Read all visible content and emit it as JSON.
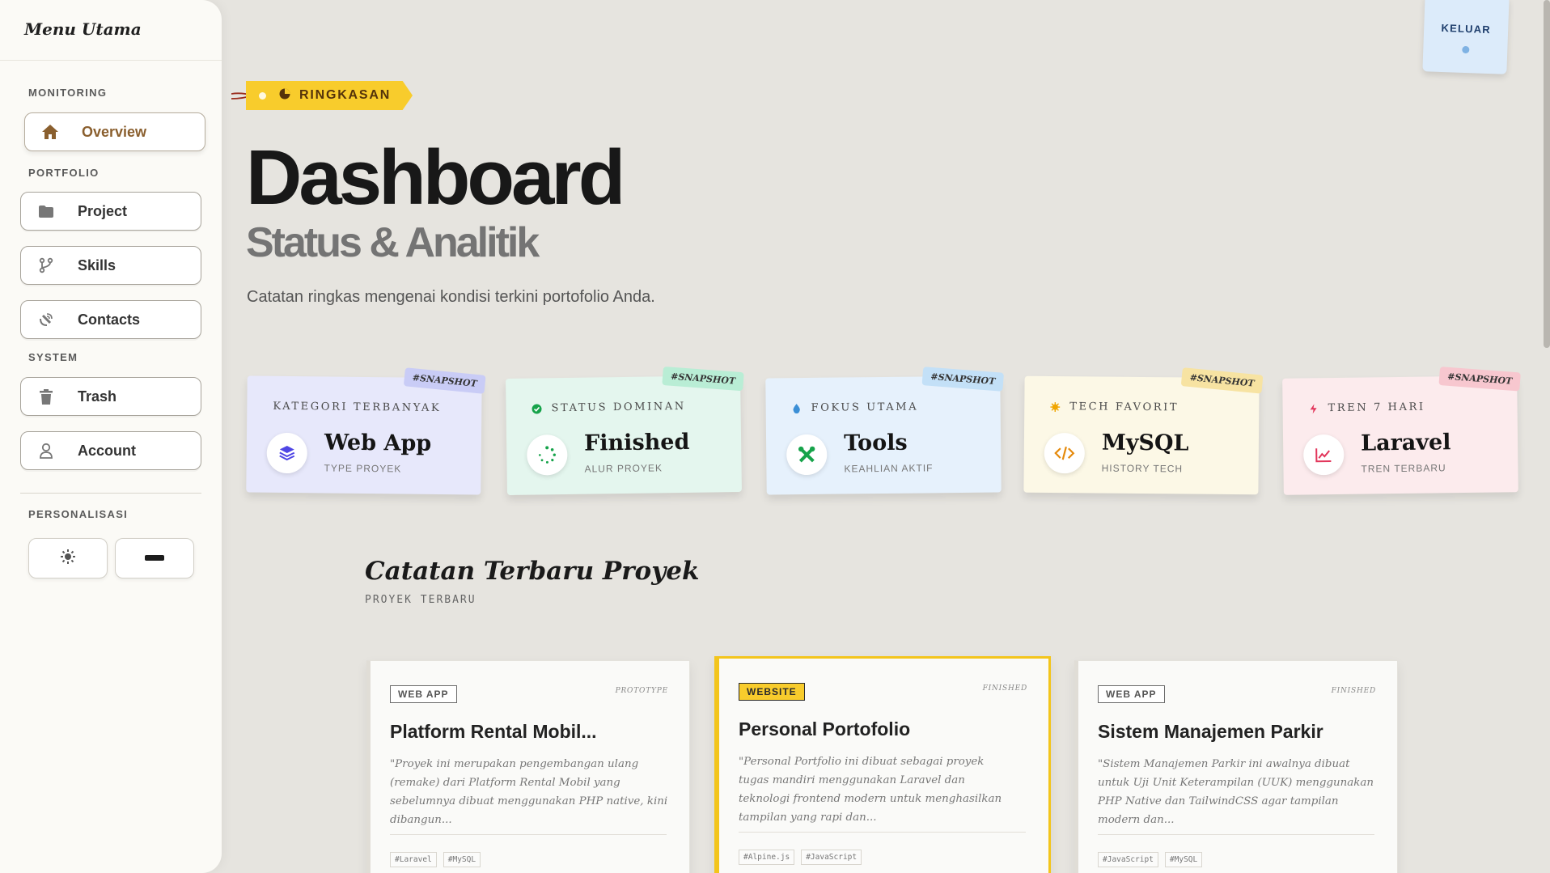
{
  "sidebar": {
    "title": "Menu Utama",
    "sections": {
      "monitoring": "MONITORING",
      "portfolio": "PORTFOLIO",
      "system": "SYSTEM",
      "personalization": "PERSONALISASI"
    },
    "items": [
      {
        "label": "Overview",
        "icon": "home-icon"
      },
      {
        "label": "Project",
        "icon": "folder-icon"
      },
      {
        "label": "Skills",
        "icon": "git-branch-icon"
      },
      {
        "label": "Contacts",
        "icon": "satellite-icon"
      },
      {
        "label": "Trash",
        "icon": "trash-icon"
      },
      {
        "label": "Account",
        "icon": "user-icon"
      }
    ]
  },
  "header": {
    "logout_label": "KELUAR",
    "summary_tag": "RINGKASAN",
    "title": "Dashboard",
    "subtitle": "Status & Analitik",
    "description": "Catatan ringkas mengenai kondisi terkini portofolio Anda."
  },
  "stats": [
    {
      "caption": "KATEGORI TERBANYAK",
      "value": "Web App",
      "sub": "TYPE PROYEK",
      "badge": "#SNAPSHOT",
      "bg": "#e7e8fb",
      "badge_bg": "#c9ccf6",
      "icon": "layers-icon"
    },
    {
      "caption": "STATUS DOMINAN",
      "value": "Finished",
      "sub": "ALUR PROYEK",
      "badge": "#SNAPSHOT",
      "bg": "#e4f6ee",
      "badge_bg": "#b9edd5",
      "icon": "loader-icon"
    },
    {
      "caption": "FOKUS UTAMA",
      "value": "Tools",
      "sub": "KEAHLIAN AKTIF",
      "badge": "#SNAPSHOT",
      "bg": "#e6f1fc",
      "badge_bg": "#c3e0f7",
      "icon": "tools-icon"
    },
    {
      "caption": "TECH FAVORIT",
      "value": "MySQL",
      "sub": "HISTORY TECH",
      "badge": "#SNAPSHOT",
      "bg": "#fcf8e6",
      "badge_bg": "#f7e3a2",
      "icon": "code-icon"
    },
    {
      "caption": "TREN 7 HARI",
      "value": "Laravel",
      "sub": "TREN TERBARU",
      "badge": "#SNAPSHOT",
      "bg": "#fcebed",
      "badge_bg": "#f7c7cf",
      "icon": "trend-icon"
    }
  ],
  "section": {
    "title": "Catatan Terbaru Proyek",
    "sub": "PROYEK TERBARU"
  },
  "projects": [
    {
      "type": "WEB APP",
      "status": "PROTOTYPE",
      "title": "Platform Rental Mobil...",
      "desc": "\"Proyek ini merupakan pengembangan ulang (remake) dari Platform Rental Mobil yang sebelumnya dibuat menggunakan PHP native, kini dibangun...",
      "tags": [
        "#Laravel",
        "#MySQL"
      ]
    },
    {
      "type": "WEBSITE",
      "status": "FINISHED",
      "title": "Personal Portofolio",
      "desc": "\"Personal Portfolio ini dibuat sebagai proyek tugas mandiri menggunakan Laravel dan teknologi frontend modern untuk menghasilkan tampilan yang rapi dan...",
      "tags": [
        "#Alpine.js",
        "#JavaScript"
      ]
    },
    {
      "type": "WEB APP",
      "status": "FINISHED",
      "title": "Sistem Manajemen Parkir",
      "desc": "\"Sistem Manajemen Parkir ini awalnya dibuat untuk Uji Unit Keterampilan (UUK) menggunakan PHP Native dan TailwindCSS agar tampilan modern dan...",
      "tags": [
        "#JavaScript",
        "#MySQL"
      ]
    }
  ]
}
